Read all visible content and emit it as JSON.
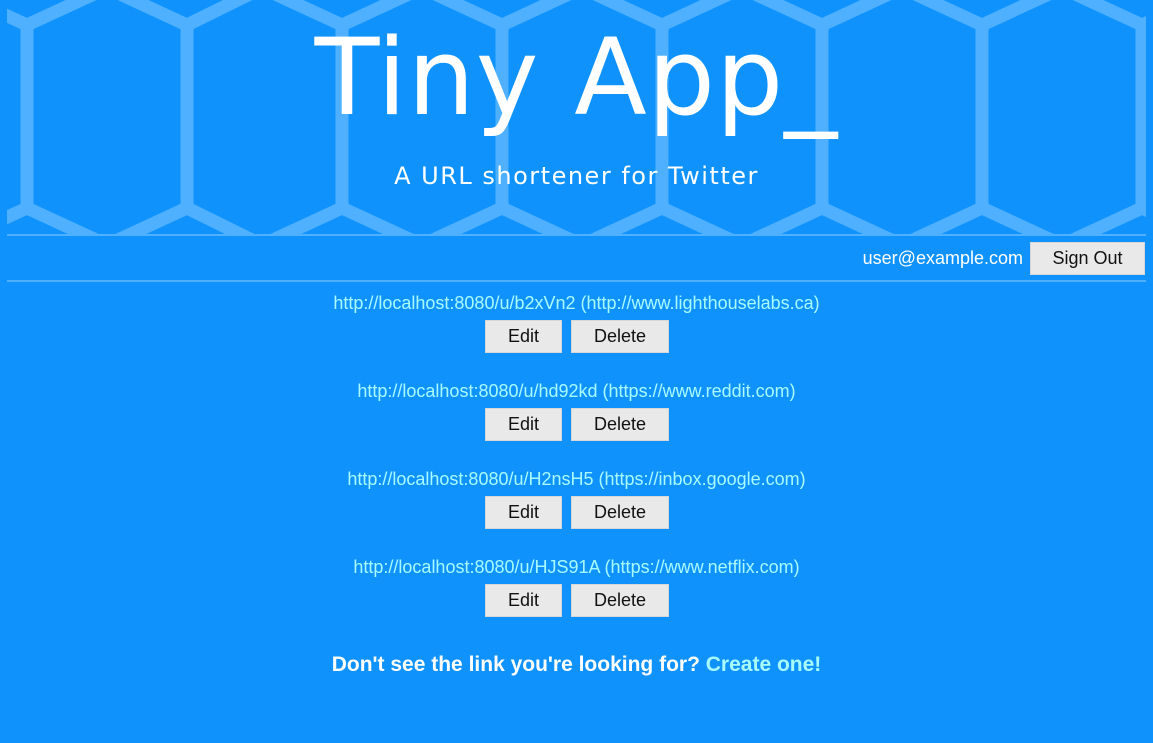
{
  "banner": {
    "title": "Tiny App_",
    "subtitle": "A URL shortener for Twitter"
  },
  "user": {
    "email": "user@example.com",
    "sign_out_label": "Sign Out"
  },
  "urls": [
    {
      "text": "http://localhost:8080/u/b2xVn2 (http://www.lighthouselabs.ca)",
      "edit_label": "Edit",
      "delete_label": "Delete"
    },
    {
      "text": "http://localhost:8080/u/hd92kd (https://www.reddit.com)",
      "edit_label": "Edit",
      "delete_label": "Delete"
    },
    {
      "text": "http://localhost:8080/u/H2nsH5 (https://inbox.google.com)",
      "edit_label": "Edit",
      "delete_label": "Delete"
    },
    {
      "text": "http://localhost:8080/u/HJS91A (https://www.netflix.com)",
      "edit_label": "Edit",
      "delete_label": "Delete"
    }
  ],
  "footer": {
    "prompt": "Don't see the link you're looking for?",
    "link_label": "Create one!"
  },
  "colors": {
    "background": "#0f92fc",
    "link": "#a7fbff",
    "button": "#e9e9e9"
  }
}
